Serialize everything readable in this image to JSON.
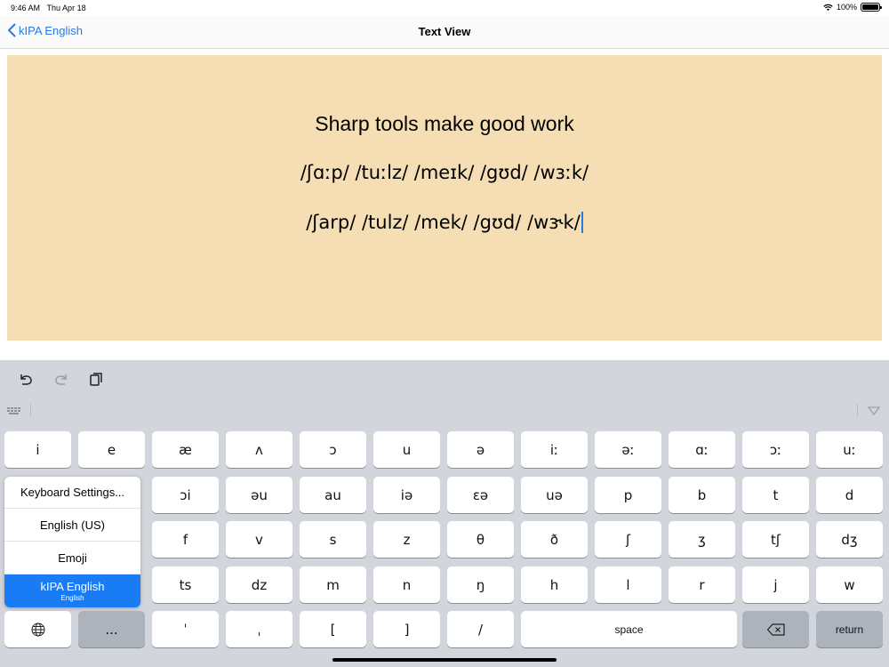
{
  "status_bar": {
    "time": "9:46 AM",
    "date": "Thu Apr 18",
    "battery": "100%"
  },
  "nav": {
    "back_label": "kIPA English",
    "title": "Text View"
  },
  "text_view": {
    "background": "#f5deb3",
    "line1": "Sharp tools make good work",
    "line2": "/ʃɑːp/  /tuːlz/  /meɪk/ /gʊd/ /wɜːk/",
    "line3": "/ʃarp/  /tulz/ /mek/ /gʊd/ /wɝk/"
  },
  "keyboard": {
    "row1": [
      "i",
      "e",
      "æ",
      "ʌ",
      "ɔ",
      "u",
      "ə",
      "iː",
      "əː",
      "ɑː",
      "ɔː",
      "uː"
    ],
    "row2": [
      "ɔi",
      "əu",
      "au",
      "iə",
      "ɛə",
      "uə",
      "p",
      "b",
      "t",
      "d"
    ],
    "row3": [
      "f",
      "v",
      "s",
      "z",
      "θ",
      "ð",
      "ʃ",
      "ʒ",
      "tʃ",
      "dʒ"
    ],
    "row4": [
      "ts",
      "dz",
      "m",
      "n",
      "ŋ",
      "h",
      "l",
      "r",
      "j",
      "w"
    ],
    "row5": {
      "more": "...",
      "apostrophe": "ˈ",
      "comma": "ˌ",
      "lbracket": "[",
      "rbracket": "]",
      "slash": "/",
      "space": "space",
      "return": "return"
    }
  },
  "language_popup": {
    "items": [
      "Keyboard Settings...",
      "English (US)",
      "Emoji"
    ],
    "selected": {
      "label": "kIPA English",
      "sub": "English"
    },
    "accent": "#1a7cf4"
  }
}
